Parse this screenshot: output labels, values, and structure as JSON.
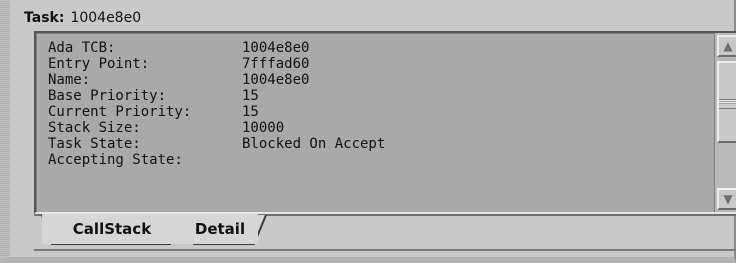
{
  "window": {
    "header_label": "Task:",
    "header_value": "1004e8e0"
  },
  "detail": {
    "rows": [
      {
        "label": "Ada TCB:",
        "value": "1004e8e0"
      },
      {
        "label": "Entry Point:",
        "value": "7fffad60"
      },
      {
        "label": "Name:",
        "value": "1004e8e0"
      },
      {
        "label": "Base Priority:",
        "value": "15"
      },
      {
        "label": "Current Priority:",
        "value": "15"
      },
      {
        "label": "Stack Size:",
        "value": "10000"
      },
      {
        "label": "Task State:",
        "value": "Blocked On Accept"
      },
      {
        "label": "Accepting State:",
        "value": ""
      }
    ]
  },
  "tabs": [
    {
      "label": "CallStack"
    },
    {
      "label": "Detail"
    }
  ],
  "icons": {
    "scroll_up": "triangle-up-icon",
    "scroll_down": "triangle-down-icon"
  }
}
